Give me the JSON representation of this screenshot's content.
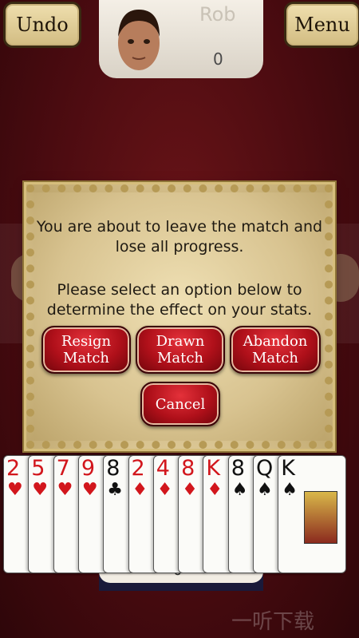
{
  "top_bar": {
    "undo_label": "Undo",
    "menu_label": "Menu"
  },
  "opponent": {
    "name": "Rob",
    "score": "0"
  },
  "dialog": {
    "line1": "You are about to leave the match and",
    "line2": "lose all progress.",
    "line3": "Please select an option below to",
    "line4": "determine the effect on your stats.",
    "resign": {
      "line1": "Resign",
      "line2": "Match"
    },
    "drawn": {
      "line1": "Drawn",
      "line2": "Match"
    },
    "abandon": {
      "line1": "Abandon",
      "line2": "Match"
    },
    "cancel_label": "Cancel"
  },
  "hand": [
    {
      "rank": "2",
      "suit": "♥",
      "color": "red"
    },
    {
      "rank": "5",
      "suit": "♥",
      "color": "red"
    },
    {
      "rank": "7",
      "suit": "♥",
      "color": "red"
    },
    {
      "rank": "9",
      "suit": "♥",
      "color": "red"
    },
    {
      "rank": "8",
      "suit": "♣",
      "color": "black"
    },
    {
      "rank": "2",
      "suit": "♦",
      "color": "red"
    },
    {
      "rank": "4",
      "suit": "♦",
      "color": "red"
    },
    {
      "rank": "8",
      "suit": "♦",
      "color": "red"
    },
    {
      "rank": "K",
      "suit": "♦",
      "color": "red"
    },
    {
      "rank": "8",
      "suit": "♠",
      "color": "black"
    },
    {
      "rank": "Q",
      "suit": "♠",
      "color": "black"
    },
    {
      "rank": "K",
      "suit": "♠",
      "color": "black"
    }
  ],
  "player": {
    "score": "0"
  },
  "watermark": "一听下载"
}
